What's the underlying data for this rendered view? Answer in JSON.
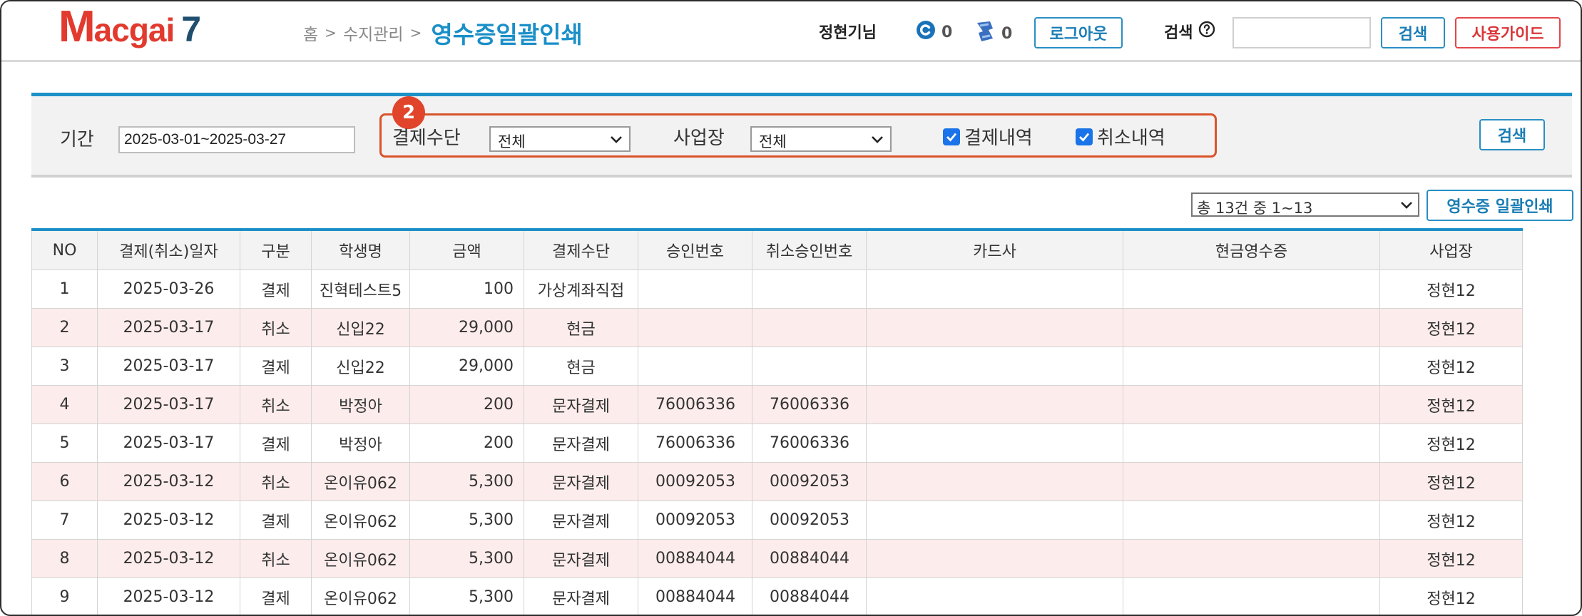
{
  "logo": {
    "m": "M",
    "rest": "acgai",
    "version": "7"
  },
  "breadcrumb": {
    "home": "홈",
    "sep": ">",
    "parent": "수지관리",
    "current": "영수증일괄인쇄"
  },
  "user": {
    "name": "정현기님",
    "coin_count": "0",
    "ticket_count": "0"
  },
  "header_buttons": {
    "logout": "로그아웃",
    "search_label": "검색",
    "search_button": "검색",
    "guide": "사용가이드",
    "search_value": ""
  },
  "filter": {
    "period_label": "기간",
    "period_value": "2025-03-01~2025-03-27",
    "step_badge": "2",
    "payment_label": "결제수단",
    "payment_value": "전체",
    "branch_label": "사업장",
    "branch_value": "전체",
    "chk_payment_label": "결제내역",
    "chk_cancel_label": "취소내역",
    "search_button": "검색"
  },
  "paging": {
    "summary": "총 13건 중 1~13",
    "print_button": "영수증 일괄인쇄"
  },
  "table": {
    "headers": [
      "NO",
      "결제(취소)일자",
      "구분",
      "학생명",
      "금액",
      "결제수단",
      "승인번호",
      "취소승인번호",
      "카드사",
      "현금영수증",
      "사업장"
    ],
    "rows": [
      {
        "no": "1",
        "date": "2025-03-26",
        "type": "결제",
        "student": "진혁테스트5",
        "amount": "100",
        "method": "가상계좌직접",
        "approval": "",
        "cancel_approval": "",
        "card": "",
        "cash_receipt": "",
        "branch": "정현12",
        "cancel": false
      },
      {
        "no": "2",
        "date": "2025-03-17",
        "type": "취소",
        "student": "신입22",
        "amount": "29,000",
        "method": "현금",
        "approval": "",
        "cancel_approval": "",
        "card": "",
        "cash_receipt": "",
        "branch": "정현12",
        "cancel": true
      },
      {
        "no": "3",
        "date": "2025-03-17",
        "type": "결제",
        "student": "신입22",
        "amount": "29,000",
        "method": "현금",
        "approval": "",
        "cancel_approval": "",
        "card": "",
        "cash_receipt": "",
        "branch": "정현12",
        "cancel": false
      },
      {
        "no": "4",
        "date": "2025-03-17",
        "type": "취소",
        "student": "박정아",
        "amount": "200",
        "method": "문자결제",
        "approval": "76006336",
        "cancel_approval": "76006336",
        "card": "",
        "cash_receipt": "",
        "branch": "정현12",
        "cancel": true
      },
      {
        "no": "5",
        "date": "2025-03-17",
        "type": "결제",
        "student": "박정아",
        "amount": "200",
        "method": "문자결제",
        "approval": "76006336",
        "cancel_approval": "76006336",
        "card": "",
        "cash_receipt": "",
        "branch": "정현12",
        "cancel": false
      },
      {
        "no": "6",
        "date": "2025-03-12",
        "type": "취소",
        "student": "온이유062",
        "amount": "5,300",
        "method": "문자결제",
        "approval": "00092053",
        "cancel_approval": "00092053",
        "card": "",
        "cash_receipt": "",
        "branch": "정현12",
        "cancel": true
      },
      {
        "no": "7",
        "date": "2025-03-12",
        "type": "결제",
        "student": "온이유062",
        "amount": "5,300",
        "method": "문자결제",
        "approval": "00092053",
        "cancel_approval": "00092053",
        "card": "",
        "cash_receipt": "",
        "branch": "정현12",
        "cancel": false
      },
      {
        "no": "8",
        "date": "2025-03-12",
        "type": "취소",
        "student": "온이유062",
        "amount": "5,300",
        "method": "문자결제",
        "approval": "00884044",
        "cancel_approval": "00884044",
        "card": "",
        "cash_receipt": "",
        "branch": "정현12",
        "cancel": true
      },
      {
        "no": "9",
        "date": "2025-03-12",
        "type": "결제",
        "student": "온이유062",
        "amount": "5,300",
        "method": "문자결제",
        "approval": "00884044",
        "cancel_approval": "00884044",
        "card": "",
        "cash_receipt": "",
        "branch": "정현12",
        "cancel": false
      }
    ]
  },
  "colors": {
    "accent": "#1e90c8",
    "brand_red": "#e23a2e",
    "cancel_row": "#fdecec",
    "highlight": "#d9542b"
  },
  "icons": {
    "coin": "coin-c-icon",
    "ticket": "ticket-icon",
    "help": "question-circle-icon",
    "checkbox": "checkmark-icon",
    "dropdown": "chevron-down-icon"
  }
}
